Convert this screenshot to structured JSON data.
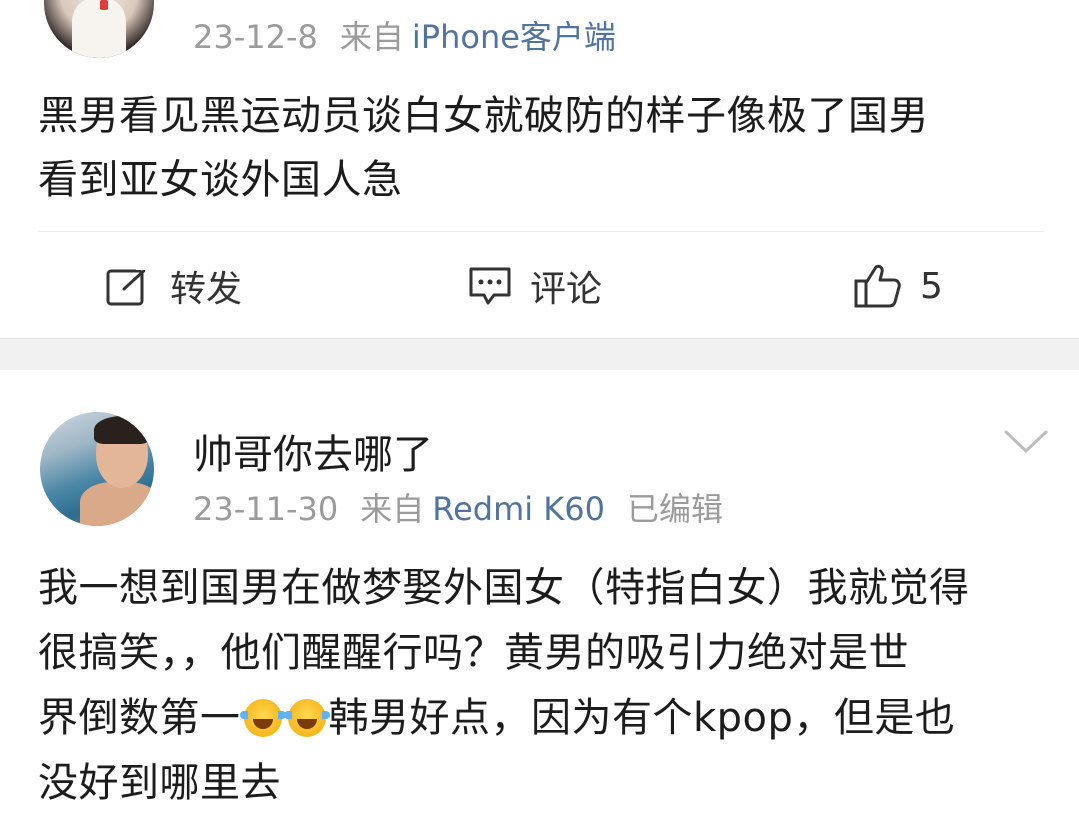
{
  "post1": {
    "date": "23-12-8",
    "source_prefix": "来自",
    "source": "iPhone客户端",
    "content_lines": [
      "黑男看见黑运动员谈白女就破防的样子像极了国男",
      "看到亚女谈外国人急"
    ],
    "actions": {
      "repost_label": "转发",
      "comment_label": "评论",
      "like_count": "5"
    }
  },
  "post2": {
    "username": "帅哥你去哪了",
    "date": "23-11-30",
    "source_prefix": "来自",
    "source": "Redmi K60",
    "edited": "已编辑",
    "content_lines": {
      "l1": "我一想到国男在做梦娶外国女（特指白女）我就觉得",
      "l2": "很搞笑，，他们醒醒行吗？黄男的吸引力绝对是世",
      "l3a": "界倒数第一",
      "l3b": "韩男好点，因为有个kpop，但是也",
      "l4": "没好到哪里去"
    },
    "emoji_name": "laugh-cry-emoji"
  },
  "colors": {
    "meta_gray": "#9b9b9b",
    "source_blue": "#51739e",
    "separator": "#f1f1f1"
  }
}
